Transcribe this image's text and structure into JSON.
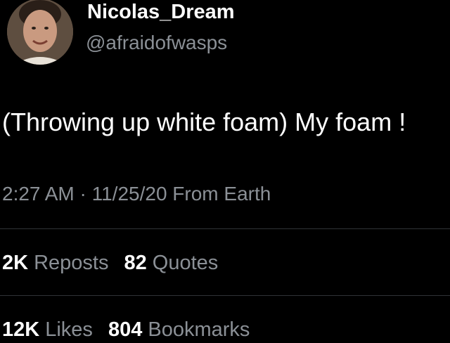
{
  "author": {
    "display_name": "Nicolas_Dream",
    "handle": "@afraidofwasps"
  },
  "tweet": {
    "text": "(Throwing up white foam) My foam !",
    "timestamp": "2:27 AM · 11/25/20 From Earth"
  },
  "stats": {
    "row1": [
      {
        "count": "2K",
        "label": "Reposts"
      },
      {
        "count": "82",
        "label": "Quotes"
      }
    ],
    "row2": [
      {
        "count": "12K",
        "label": "Likes"
      },
      {
        "count": "804",
        "label": "Bookmarks"
      }
    ]
  },
  "colors": {
    "background": "#000000",
    "primary_text": "#ffffff",
    "secondary_text": "#8b9096",
    "divider": "#2f3336"
  }
}
